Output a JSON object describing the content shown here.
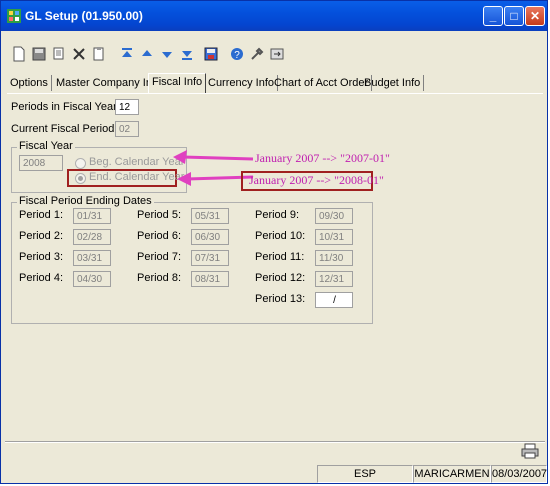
{
  "window": {
    "title": "GL Setup (01.950.00)"
  },
  "toolbar": {
    "icons": [
      "new-icon",
      "save-icon",
      "copy-icon",
      "delete-icon",
      "paste-icon",
      "first-icon",
      "previous-icon",
      "next-icon",
      "last-icon",
      "save-disk-icon",
      "help-icon",
      "tools-icon",
      "exit-icon"
    ]
  },
  "tabs": [
    {
      "label": "Options"
    },
    {
      "label": "Master Company Info"
    },
    {
      "label": "Fiscal Info"
    },
    {
      "label": "Currency Info"
    },
    {
      "label": "Chart of Acct Order"
    },
    {
      "label": "Budget Info"
    }
  ],
  "fiscal": {
    "periods_label": "Periods in Fiscal Year:",
    "periods_value": "12",
    "current_label": "Current Fiscal Period:",
    "current_value": "02",
    "year_group_title": "Fiscal Year",
    "year_value": "2008",
    "beg_radio_label": "Beg. Calendar Year",
    "end_radio_label": "End. Calendar Year",
    "annotation_1": "January 2007 --> \"2007-01\"",
    "annotation_2": "January 2007 --> \"2008-01\""
  },
  "periods_group_title": "Fiscal Period Ending Dates",
  "periods": [
    {
      "label": "Period  1:",
      "value": "01/31"
    },
    {
      "label": "Period  2:",
      "value": "02/28"
    },
    {
      "label": "Period  3:",
      "value": "03/31"
    },
    {
      "label": "Period  4:",
      "value": "04/30"
    },
    {
      "label": "Period  5:",
      "value": "05/31"
    },
    {
      "label": "Period  6:",
      "value": "06/30"
    },
    {
      "label": "Period  7:",
      "value": "07/31"
    },
    {
      "label": "Period  8:",
      "value": "08/31"
    },
    {
      "label": "Period  9:",
      "value": "09/30"
    },
    {
      "label": "Period  10:",
      "value": "10/31"
    },
    {
      "label": "Period  11:",
      "value": "11/30"
    },
    {
      "label": "Period  12:",
      "value": "12/31"
    },
    {
      "label": "Period  13:",
      "value": "/"
    }
  ],
  "status": {
    "language": "ESP",
    "user": "MARICARMEN",
    "date": "08/03/2007"
  },
  "colors": {
    "title_bar": "#0450dc",
    "annotation_arrow": "#e040c0",
    "annotation_box": "#a02020"
  }
}
